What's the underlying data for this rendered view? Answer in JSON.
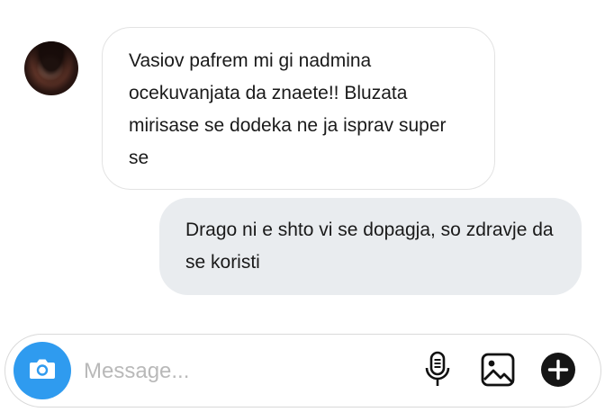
{
  "thread": {
    "incoming": {
      "avatar_icon": "user-avatar",
      "text": "Vasiov pafrem mi gi nadmina ocekuvanjata da znaete!! Bluzata mirisase se dodeka ne ja isprav super se"
    },
    "outgoing": {
      "text": "Drago ni e shto vi se dopagja, so zdravje da se koristi"
    }
  },
  "composer": {
    "placeholder": "Message...",
    "camera_icon": "camera-icon",
    "mic_icon": "microphone-icon",
    "image_icon": "image-icon",
    "add_icon": "plus-circle-icon",
    "accent_color": "#2f9bef"
  }
}
